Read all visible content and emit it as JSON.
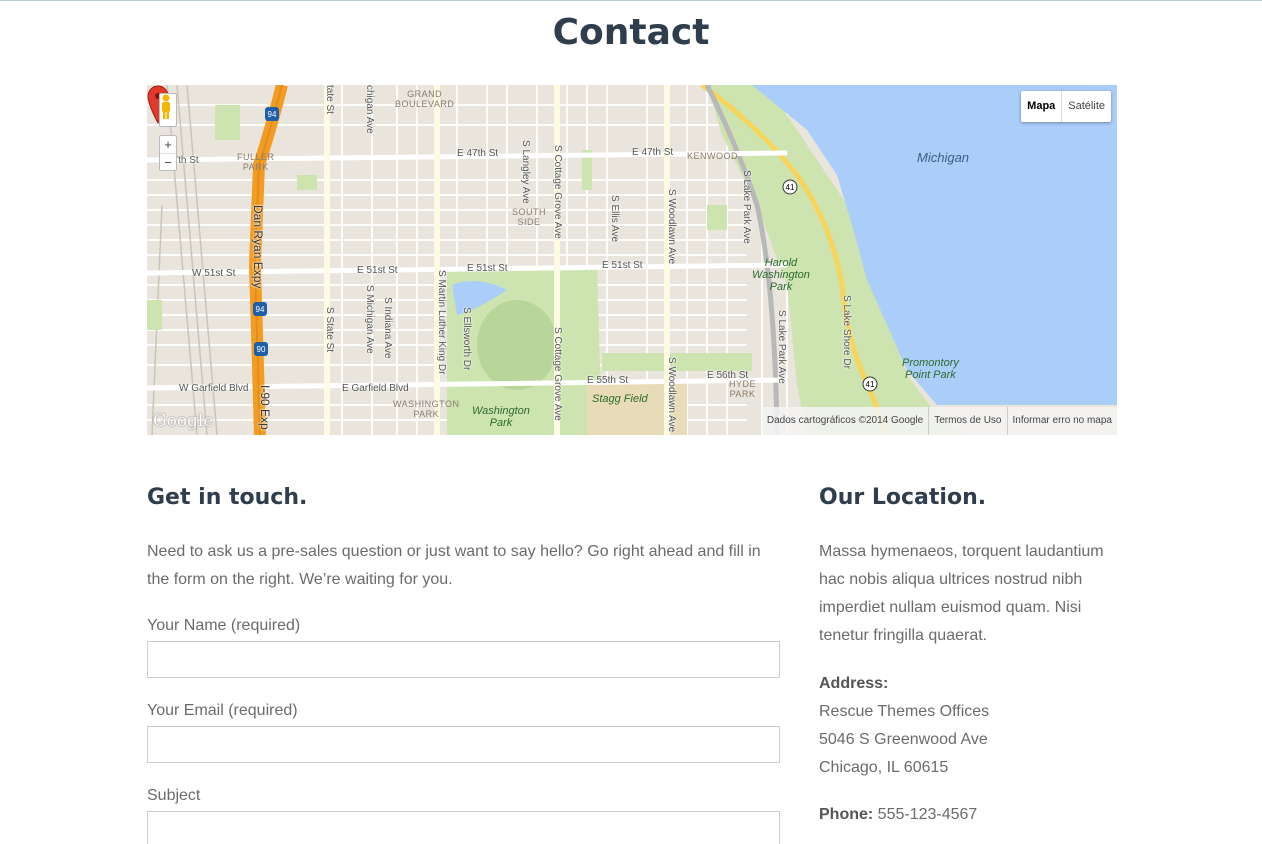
{
  "page": {
    "title": "Contact"
  },
  "map": {
    "maptype": {
      "map_label": "Mapa",
      "satellite_label": "Satélite"
    },
    "zoom": {
      "in": "+",
      "out": "−"
    },
    "attribution": {
      "data": "Dados cartográficos ©2014 Google",
      "terms": "Termos de Uso",
      "report": "Informar erro no mapa"
    },
    "logo": "Google",
    "lake": "Michigan",
    "streets": {
      "e47": "E 47th St",
      "e47b": "E 47th St",
      "w47": "47th St",
      "w51": "W 51st St",
      "e51a": "E 51st St",
      "e51b": "E 51st St",
      "e51c": "E 51st St",
      "e55": "E 55th St",
      "e56": "E 56th St",
      "garfield_w": "W Garfield Blvd",
      "garfield_e": "E Garfield Blvd",
      "dan_ryan": "Dan Ryan Expy",
      "i90": "I-90 Exp",
      "state": "S State St",
      "michigan": "S Michigan Ave",
      "indiana": "S Indiana Ave",
      "mlk": "S Martin Luther King Dr",
      "ellsworth": "S Ellsworth Dr",
      "cottage1": "S Cottage Grove Ave",
      "cottage2": "S Cottage Grove Ave",
      "langley": "S Langley Ave",
      "ellis": "S Ellis Ave",
      "woodlawn1": "S Woodlawn Ave",
      "woodlawn2": "S Woodlawn Ave",
      "lakepark1": "S Lake Park Ave",
      "lakepark2": "S Lake Park Ave",
      "lakeshore": "S Lake Shore Dr",
      "statetop": "tate St",
      "michtop": "chigan Ave"
    },
    "areas": {
      "grand": "GRAND\nBOULEVARD",
      "fuller": "FULLER\nPARK",
      "south_side": "SOUTH\nSIDE",
      "kenwood": "KENWOOD",
      "washington_park_area": "WASHINGTON\nPARK",
      "hyde": "HYDE\nPARK"
    },
    "parks": {
      "harold": "Harold\nWashington\nPark",
      "promontory": "Promontory\nPoint Park",
      "washington": "Washington\nPark",
      "stagg": "Stagg Field"
    },
    "shields": {
      "i94a": "94",
      "i94b": "94",
      "i90": "90",
      "us41a": "41",
      "us41b": "41"
    }
  },
  "contact": {
    "heading": "Get in touch.",
    "intro": "Need to ask us a pre-sales question or just want to say hello? Go right ahead and fill in the form on the right. We’re waiting for you.",
    "fields": {
      "name_label": "Your Name (required)",
      "email_label": "Your Email (required)",
      "subject_label": "Subject",
      "name_value": "",
      "email_value": "",
      "subject_value": ""
    }
  },
  "location": {
    "heading": "Our Location.",
    "text": "Massa hymenaeos, torquent laudantium hac nobis aliqua ultrices nostrud nibh imperdiet nullam euismod quam. Nisi tenetur fringilla quaerat.",
    "address_label": "Address:",
    "address_line1": "Rescue Themes Offices",
    "address_line2": "5046 S Greenwood Ave",
    "address_line3": "Chicago, IL 60615",
    "phone_label": "Phone:",
    "phone_value": "555-123-4567"
  },
  "colors": {
    "heading": "#2f3d4c",
    "text": "#6b6b6b",
    "water": "#abcdfa",
    "park": "#cde4b0",
    "highway": "#f39c23",
    "marker": "#e03a2f"
  }
}
